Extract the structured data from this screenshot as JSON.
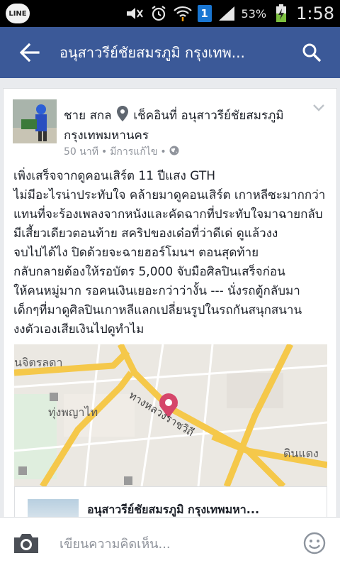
{
  "status_bar": {
    "app_badge": "LINE",
    "notification_count": "1",
    "battery_percent": "53%",
    "time": "1:58"
  },
  "app_bar": {
    "title": "อนุสาวรีย์ชัยสมรภูมิ กรุงเทพ..."
  },
  "post": {
    "author": "ชาย สกล",
    "checkin_text": "เช็คอินที่ อนุสาวรีย์ชัยสมรภูมิ",
    "checkin_city": "กรุงเทพมหานคร",
    "time_ago": "50 นาที",
    "edited": "มีการแก้ไข",
    "body_lines": [
      "เพิ่งเสร็จจากดูคอนเสิร์ต 11 ปีแสง GTH",
      "ไม่มีอะไรน่าประทับใจ คล้ายมาดูคอนเสิร์ต เกาหลีซะมากกว่า",
      "แทนที่จะร้องเพลงจากหนังและคัดฉากที่ประทับใจมาฉายกลับ",
      "มีเสี้ยวเดียวตอนท้าย สคริปของเด๋อที่ว่าดีเด่ ดูแล้วงง",
      "จบไปได้ไง ปิดด้วยจะฉายฮอร์โมนฯ ตอนสุดท้าย",
      "กลับกลายต้องให้รอบัตร 5,000 จับมือศิลปินเสร็จก่อน",
      "ให้คนหมู่มาก รอคนเงินเยอะกว่าว่างั้น --- นั่งรถตู้กลับมา",
      "เด็กๆที่มาดูศิลปินเกาหลีแลกเปลี่ยนรูปในรถกันสนุกสนาน",
      "งงตัวเองเสียเงินไปดูทำไม"
    ],
    "map_labels": {
      "area1": "นจิตรลดา",
      "area2": "ทุ่งพญาไท",
      "road": "ทางหลวงราชวิถี",
      "area3": "ดินแดง"
    },
    "link_title": "อนุสาวรีย์ชัยสมรภูมิ กรุงเทพมหา..."
  },
  "comment_bar": {
    "placeholder": "เขียนความคิดเห็น..."
  },
  "colors": {
    "brand": "#3b5998",
    "map_road": "#f5c84a",
    "pin": "#d5466a"
  }
}
